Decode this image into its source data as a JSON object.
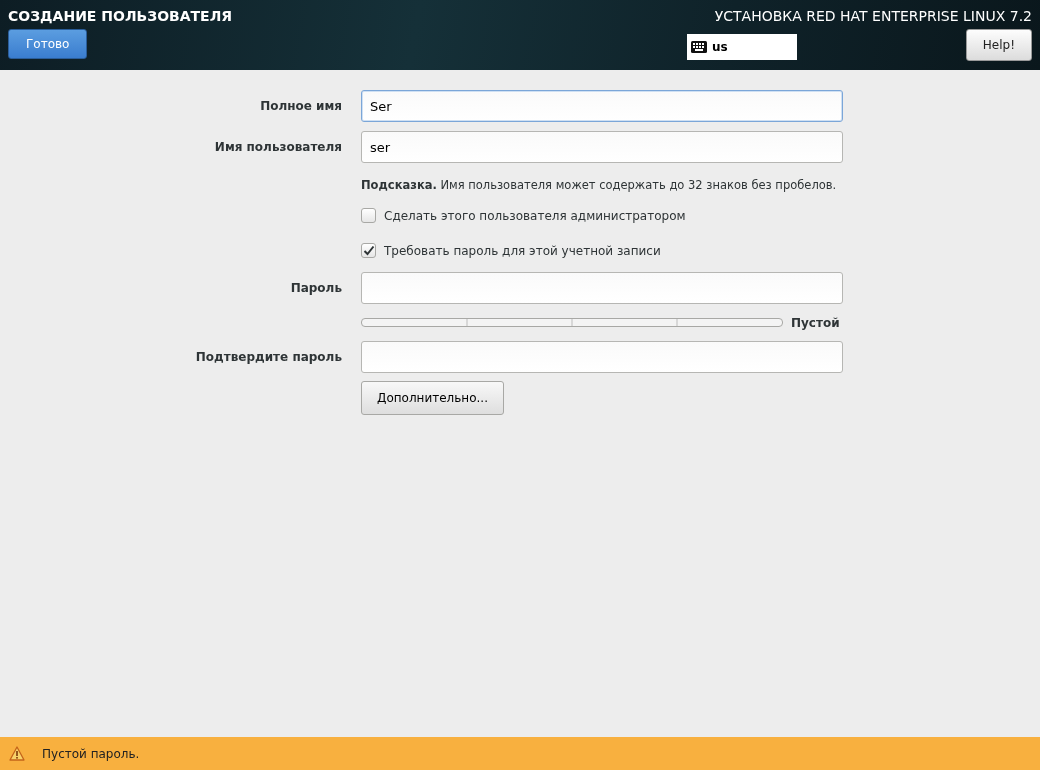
{
  "header": {
    "title": "СОЗДАНИЕ ПОЛЬЗОВАТЕЛЯ",
    "done_button": "Готово",
    "product_title": "УСТАНОВКА RED HAT ENTERPRISE LINUX 7.2",
    "keyboard_layout": "us",
    "help_button": "Help!"
  },
  "form": {
    "fields": [
      {
        "kind": "text",
        "label": "Полное имя",
        "value": "Ser",
        "focused": true
      },
      {
        "kind": "text",
        "label": "Имя пользователя",
        "value": "ser",
        "focused": false
      },
      {
        "kind": "hint",
        "text": "**Подсказка.** Имя пользователя может содержать до 32 знаков без пробелов."
      },
      {
        "kind": "checkbox",
        "label": "Сделать этого пользователя администратором",
        "checked": false
      },
      {
        "kind": "checkbox",
        "label": "Требовать пароль для этой учетной записи",
        "checked": true
      },
      {
        "kind": "password",
        "label": "Пароль",
        "focused": false
      },
      {
        "kind": "meter",
        "level": 0,
        "reading": "Пустой"
      },
      {
        "kind": "password",
        "label": "Подтвердите пароль",
        "focused": false
      },
      {
        "kind": "button",
        "label": "Дополнительно..."
      }
    ]
  },
  "status_bar": {
    "message": "Пустой пароль."
  }
}
